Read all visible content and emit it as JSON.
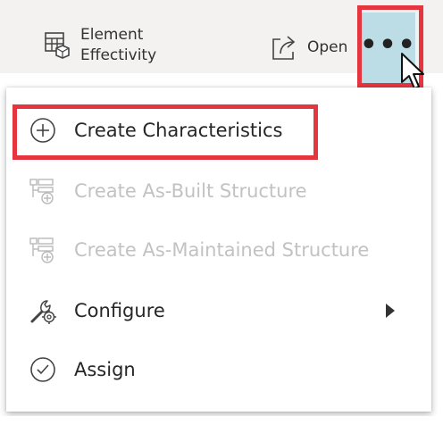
{
  "toolbar": {
    "element_effectivity_line1": "Element",
    "element_effectivity_line2": "Effectivity",
    "open_label": "Open",
    "more_label": "•••"
  },
  "menu": {
    "items": [
      {
        "label": "Create Characteristics",
        "icon": "plus-circle-icon",
        "disabled": false
      },
      {
        "label": "Create As-Built Structure",
        "icon": "structure-add-icon",
        "disabled": true
      },
      {
        "label": "Create As-Maintained Structure",
        "icon": "structure-add-icon",
        "disabled": true
      },
      {
        "label": "Configure",
        "icon": "wrench-gear-icon",
        "disabled": false,
        "has_submenu": true
      },
      {
        "label": "Assign",
        "icon": "check-circle-icon",
        "disabled": false
      }
    ]
  },
  "colors": {
    "highlight_red": "#e53640",
    "more_button_bg": "#bcdde6",
    "disabled_text": "#c2c2c2"
  }
}
